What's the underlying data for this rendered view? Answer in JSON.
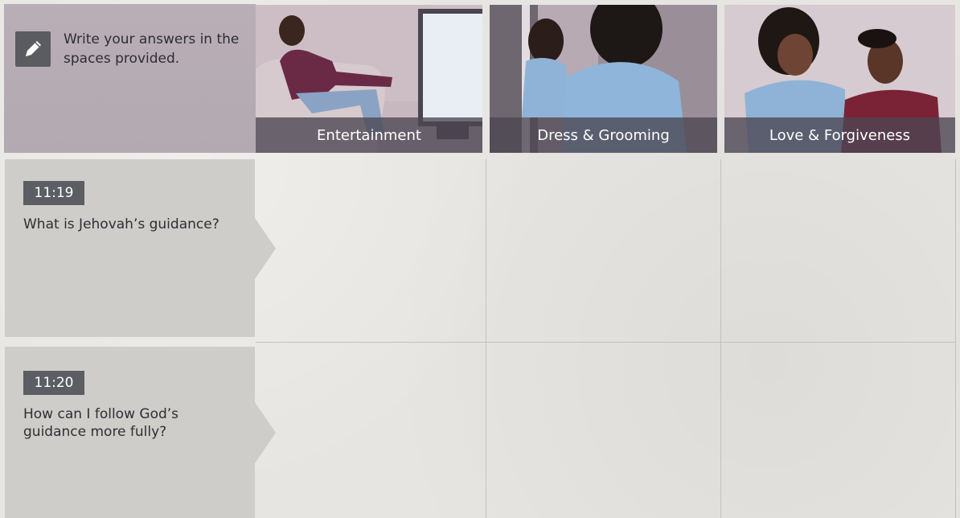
{
  "header": {
    "instruction": "Write your answers in the spaces provided.",
    "icon": "pencil-icon",
    "columns": [
      {
        "label": "Entertainment"
      },
      {
        "label": "Dress & Grooming"
      },
      {
        "label": "Love & Forgiveness"
      }
    ]
  },
  "questions": [
    {
      "ref": "11:19",
      "text": "What is Jehovah’s guidance?"
    },
    {
      "ref": "11:20",
      "text": "How can I follow God’s guidance more fully?"
    }
  ],
  "colors": {
    "panel": "#cfcdca",
    "badge": "#5d5e63",
    "header_panel": "#b9aeb6",
    "caption_bar": "#4b4752"
  }
}
